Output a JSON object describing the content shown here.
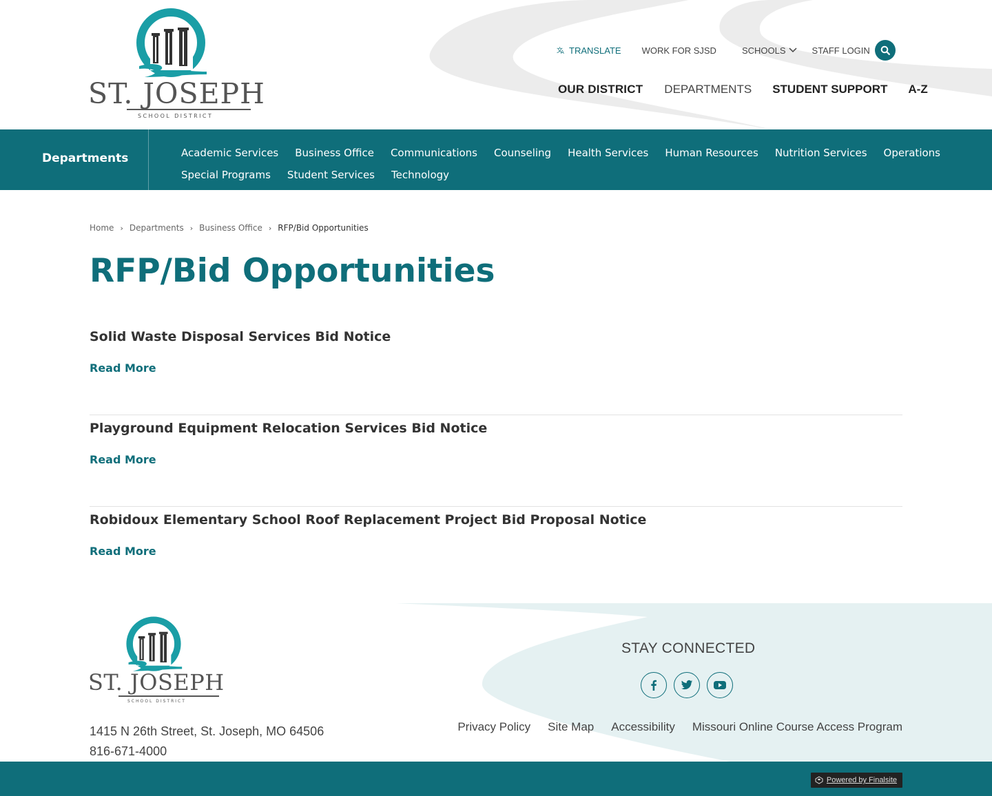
{
  "brand": {
    "name": "ST. JOSEPH",
    "subtitle": "SCHOOL DISTRICT",
    "accent_color": "#0f6e7a"
  },
  "utility_nav": {
    "translate": "TRANSLATE",
    "work": "WORK FOR SJSD",
    "schools": "SCHOOLS",
    "staff_login": "STAFF LOGIN"
  },
  "main_nav": {
    "our_district": "OUR DISTRICT",
    "departments": "DEPARTMENTS",
    "student_support": "STUDENT SUPPORT",
    "az": "A-Z"
  },
  "dept_bar": {
    "title": "Departments",
    "links_row1": [
      "Academic Services",
      "Business Office",
      "Communications",
      "Counseling",
      "Health Services",
      "Human Resources",
      "Nutrition Services",
      "Operations"
    ],
    "links_row2": [
      "Special Programs",
      "Student Services",
      "Technology"
    ]
  },
  "breadcrumb": {
    "home": "Home",
    "departments": "Departments",
    "business_office": "Business Office",
    "current": "RFP/Bid Opportunities"
  },
  "page": {
    "title": "RFP/Bid Opportunities"
  },
  "bids": [
    {
      "title": "Solid Waste Disposal Services Bid Notice",
      "link": "Read More"
    },
    {
      "title": "Playground Equipment Relocation Services Bid Notice",
      "link": "Read More"
    },
    {
      "title": "Robidoux Elementary School Roof Replacement Project Bid Proposal Notice",
      "link": "Read More"
    }
  ],
  "footer": {
    "address": "1415 N 26th Street,  St. Joseph, MO  64506",
    "phone": "816-671-4000",
    "stay_connected": "STAY CONNECTED",
    "social_icons": [
      "facebook-icon",
      "twitter-icon",
      "youtube-icon"
    ],
    "links": [
      "Privacy Policy",
      "Site Map",
      "Accessibility",
      "Missouri Online Course Access Program"
    ],
    "powered_by": "Powered by Finalsite"
  }
}
